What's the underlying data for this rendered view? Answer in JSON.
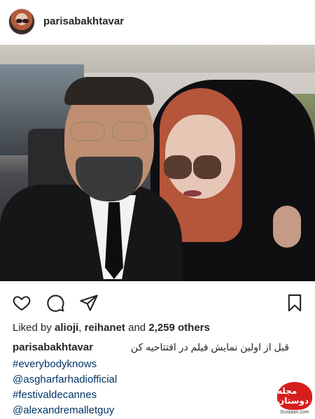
{
  "header": {
    "username": "parisabakhtavar",
    "avatar_icon": "profile-avatar"
  },
  "actions": {
    "like_icon": "heart-icon",
    "comment_icon": "comment-bubble-icon",
    "share_icon": "paper-plane-icon",
    "save_icon": "bookmark-icon"
  },
  "likes": {
    "prefix": "Liked by ",
    "user1": "alioji",
    "separator": ", ",
    "user2": "reihanet",
    "and": " and ",
    "count": "2,259 others"
  },
  "caption": {
    "username": "parisabakhtavar",
    "text": "قبل از اولین نمایش فیلم در افتتاحیه کن",
    "tags": [
      "#everybodyknows",
      "@asgharfarhadiofficial",
      "#festivaldecannes",
      "@alexandremalletguy"
    ]
  },
  "watermark": {
    "title": "مجله دوستان",
    "site": "Dustaan.com"
  },
  "colors": {
    "text": "#262626",
    "link": "#003569",
    "watermark": "#d71e1e"
  }
}
